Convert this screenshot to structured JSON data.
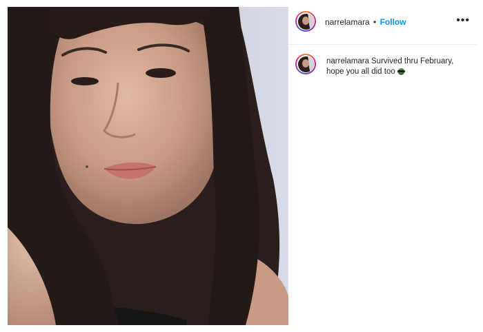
{
  "post": {
    "username": "narrelamara",
    "separator": "•",
    "follow_label": "Follow",
    "more_label": "•••",
    "caption": {
      "username": "narrelamara",
      "text": "Survived thru February, hope you all did too"
    },
    "caption_emoji_icon": "sunglasses-face-emoji-icon"
  },
  "colors": {
    "follow_blue": "#0095f6",
    "text": "#262626",
    "divider": "#efefef"
  }
}
